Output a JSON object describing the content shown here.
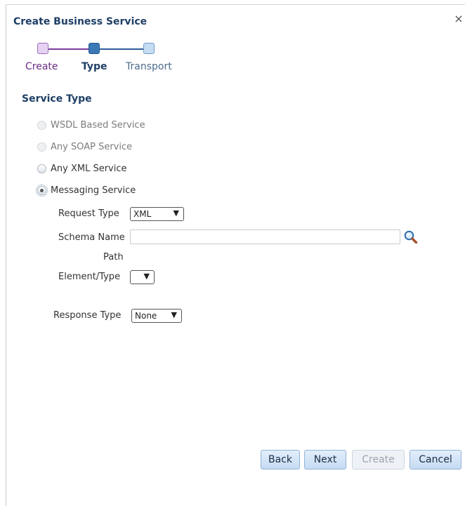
{
  "dialog": {
    "title": "Create Business Service",
    "close_glyph": "×"
  },
  "train": {
    "steps": [
      {
        "label": "Create",
        "state": "visited"
      },
      {
        "label": "Type",
        "state": "current"
      },
      {
        "label": "Transport",
        "state": "unvisited"
      }
    ]
  },
  "service_type": {
    "heading": "Service Type",
    "options": [
      {
        "label": "WSDL Based Service",
        "selected": false,
        "disabled": true
      },
      {
        "label": "Any SOAP Service",
        "selected": false,
        "disabled": true
      },
      {
        "label": "Any XML Service",
        "selected": false,
        "disabled": false
      },
      {
        "label": "Messaging Service",
        "selected": true,
        "disabled": false
      }
    ]
  },
  "messaging": {
    "request_type_label": "Request Type",
    "request_type_value": "XML",
    "schema_name_label": "Schema Name",
    "schema_name_value": "",
    "path_label": "Path",
    "element_type_label": "Element/Type",
    "element_type_value": "",
    "response_type_label": "Response Type",
    "response_type_value": "None",
    "search_icon": "search-magnifier"
  },
  "buttons": {
    "back": "Back",
    "next": "Next",
    "create": "Create",
    "cancel": "Cancel"
  },
  "colors": {
    "title": "#1f3f66",
    "train_visited": "#7d3b9a",
    "train_current": "#3b78b6",
    "button_bg": "#c5dbf2"
  }
}
